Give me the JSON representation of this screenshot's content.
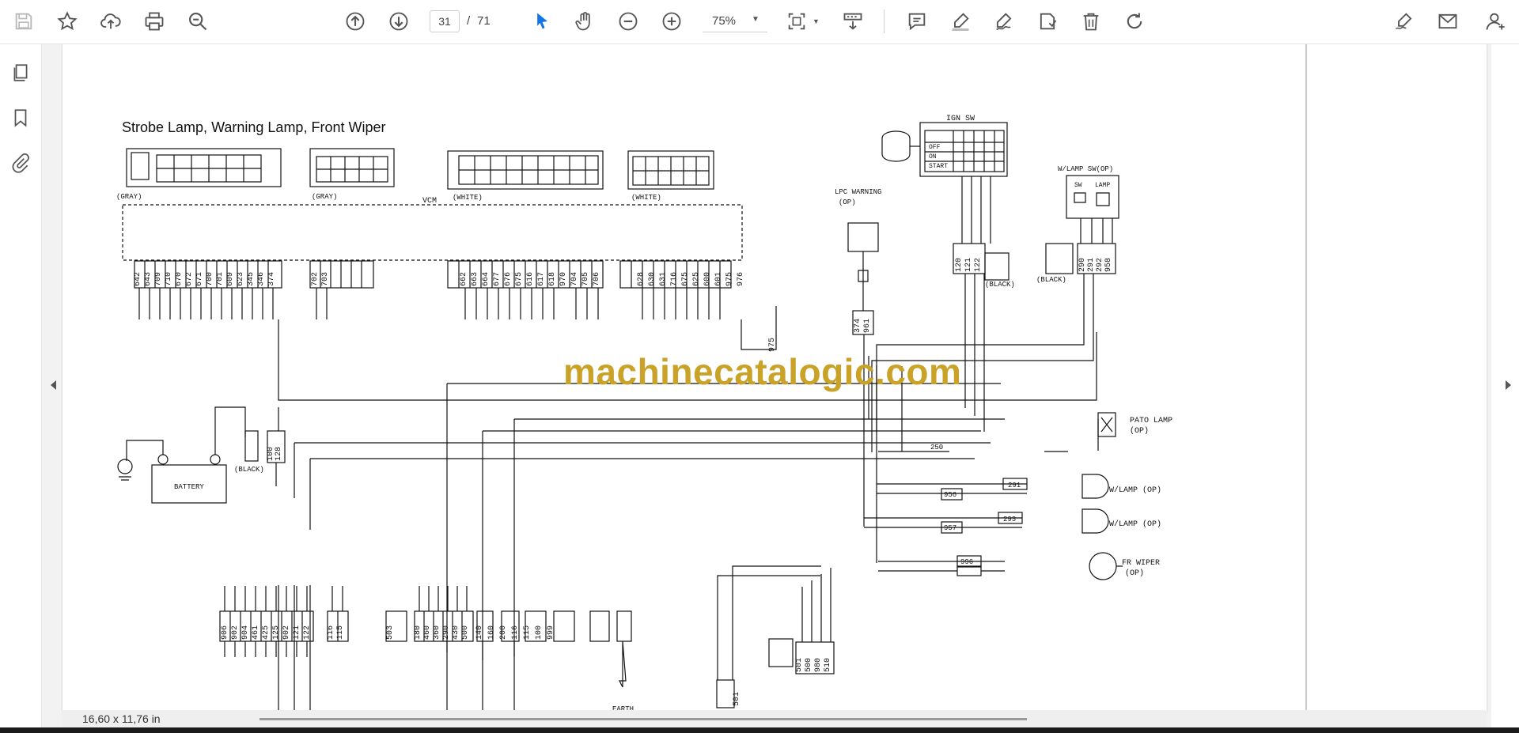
{
  "toolbar": {
    "page_current": "31",
    "page_separator": "/",
    "page_total": "71",
    "zoom": "75%",
    "icons": [
      "save-icon",
      "star-icon",
      "cloud-upload-icon",
      "print-icon",
      "search-zoom-icon",
      "page-up-icon",
      "page-down-icon",
      "select-cursor-icon",
      "hand-icon",
      "zoom-out-icon",
      "zoom-in-icon",
      "zoom-dropdown-icon",
      "fit-page-icon",
      "scroll-mode-icon",
      "comment-icon",
      "highlight-icon",
      "draw-icon",
      "stamp-icon",
      "delete-icon",
      "rotate-icon",
      "sign-icon",
      "email-icon",
      "account-icon"
    ]
  },
  "left_rail": {
    "icons": [
      "pages-icon",
      "bookmark-icon",
      "attachment-icon"
    ]
  },
  "document": {
    "title": "Strobe Lamp, Warning Lamp, Front Wiper",
    "watermark": "machinecatalogic.com",
    "connectors": {
      "gray1": "(GRAY)",
      "gray2": "(GRAY)",
      "white1": "(WHITE)",
      "white2": "(WHITE)",
      "vcm": "VCM",
      "ign_sw": "IGN SW",
      "off": "OFF",
      "on": "ON",
      "start": "START",
      "lpc_warning": "LPC WARNING",
      "op": "(OP)",
      "wlamp_sw": "W/LAMP SW(OP)",
      "sw": "SW",
      "lamp": "LAMP",
      "black": "(BLACK)",
      "pato_lamp": "PATO LAMP",
      "wlamp_op": "W/LAMP (OP)",
      "fr_wiper": "FR WIPER",
      "battery": "BATTERY",
      "earth": "EARTH"
    },
    "wire_numbers": {
      "group1": [
        "642",
        "643",
        "709",
        "710",
        "670",
        "672",
        "671",
        "700",
        "701",
        "609",
        "623",
        "345",
        "346",
        "374"
      ],
      "group2": [
        "702",
        "703"
      ],
      "group3": [
        "662",
        "663",
        "664",
        "677",
        "676",
        "675",
        "616",
        "617",
        "618",
        "970",
        "704",
        "705",
        "706"
      ],
      "group4": [
        "628",
        "630",
        "631",
        "716",
        "675",
        "625",
        "600",
        "601",
        "975",
        "976"
      ],
      "ign": [
        "120",
        "121",
        "122"
      ],
      "wlamp": [
        "290",
        "291",
        "292",
        "958"
      ],
      "lpc": [
        "374",
        "961"
      ],
      "bottom1": [
        "906",
        "902",
        "904",
        "461",
        "425",
        "125",
        "902",
        "121",
        "122"
      ],
      "bottom2": [
        "116",
        "115"
      ],
      "bottom3": [
        "503"
      ],
      "bottom4": [
        "180",
        "460",
        "360",
        "290",
        "430",
        "500"
      ],
      "bottom5": [
        "140",
        "160",
        "200",
        "116",
        "115",
        "100",
        "999"
      ],
      "bottom6": [
        "501",
        "500",
        "980",
        "510"
      ],
      "bat": [
        "100",
        "128"
      ]
    },
    "side_labels": {
      "w250": "250",
      "w291": "291",
      "w956": "956",
      "w293": "293",
      "w957": "957",
      "w996": "996",
      "w975": "975",
      "w501": "501"
    }
  },
  "status": {
    "page_size": "16,60 x 11,76 in"
  }
}
